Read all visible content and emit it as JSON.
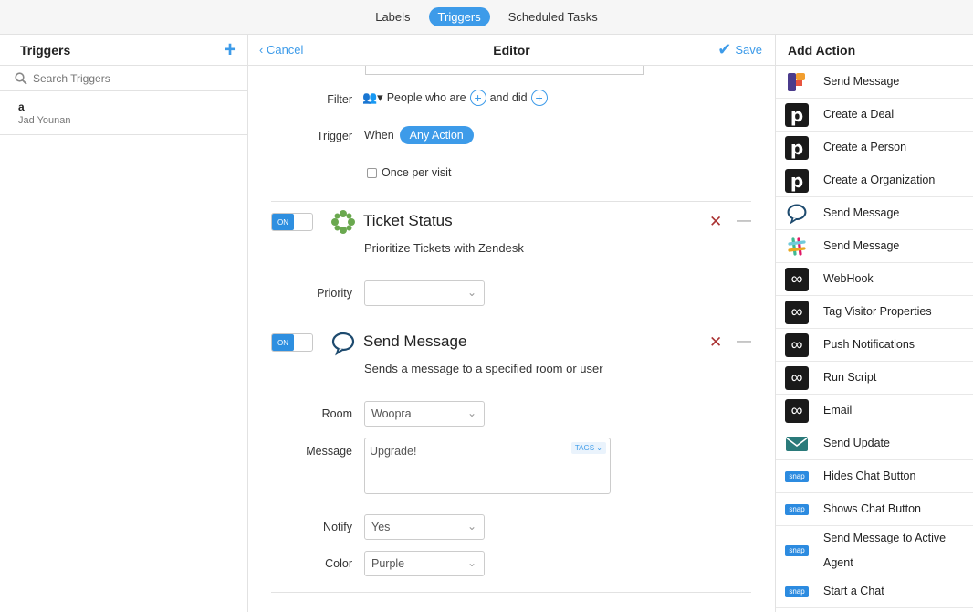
{
  "top_tabs": [
    "Labels",
    "Triggers",
    "Scheduled Tasks"
  ],
  "left": {
    "title": "Triggers",
    "search_placeholder": "Search Triggers",
    "items": [
      {
        "name": "a",
        "author": "Jad Younan"
      }
    ]
  },
  "editor": {
    "title": "Editor",
    "cancel": "Cancel",
    "save": "Save",
    "filter": {
      "label": "Filter",
      "people_text": "People who are",
      "and_did": "and did"
    },
    "trigger": {
      "label": "Trigger",
      "when": "When",
      "action_pill": "Any Action",
      "once_per_visit": "Once per visit"
    },
    "toggle_on": "ON",
    "ticket": {
      "title": "Ticket Status",
      "desc": "Prioritize Tickets with Zendesk",
      "priority_label": "Priority",
      "priority_value": ""
    },
    "message": {
      "title": "Send Message",
      "desc": "Sends a message to a specified room or user",
      "room_label": "Room",
      "room_value": "Woopra",
      "message_label": "Message",
      "message_value": "Upgrade!",
      "tags": "TAGS",
      "notify_label": "Notify",
      "notify_value": "Yes",
      "color_label": "Color",
      "color_value": "Purple"
    }
  },
  "right": {
    "title": "Add Action",
    "actions": [
      {
        "label": "Send Message",
        "icon": "fullstory-icon"
      },
      {
        "label": "Create a Deal",
        "icon": "pipedrive-icon"
      },
      {
        "label": "Create a Person",
        "icon": "pipedrive-icon"
      },
      {
        "label": "Create a Organization",
        "icon": "pipedrive-icon"
      },
      {
        "label": "Send Message",
        "icon": "hipchat-icon"
      },
      {
        "label": "Send Message",
        "icon": "slack-icon"
      },
      {
        "label": "WebHook",
        "icon": "woopra-icon"
      },
      {
        "label": "Tag Visitor Properties",
        "icon": "woopra-icon"
      },
      {
        "label": "Push Notifications",
        "icon": "woopra-icon"
      },
      {
        "label": "Run Script",
        "icon": "woopra-icon"
      },
      {
        "label": "Email",
        "icon": "woopra-icon"
      },
      {
        "label": "Send Update",
        "icon": "mail-icon"
      },
      {
        "label": "Hides Chat Button",
        "icon": "snap-icon"
      },
      {
        "label": "Shows Chat Button",
        "icon": "snap-icon"
      },
      {
        "label": "Send Message to Active Agent",
        "icon": "snap-icon"
      },
      {
        "label": "Start a Chat",
        "icon": "snap-icon"
      }
    ],
    "snap_text": "snap"
  },
  "colors": {
    "accent": "#3d9be9",
    "delete": "#aa3333",
    "zendesk_green": "#6aa84f"
  }
}
